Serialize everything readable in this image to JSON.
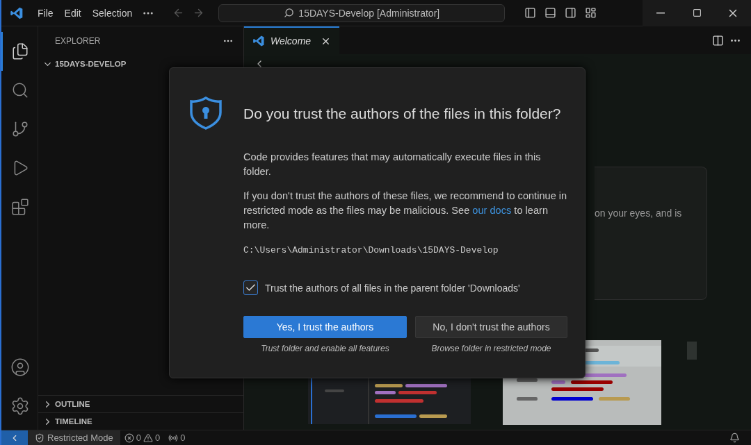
{
  "title_bar": {
    "menu": [
      "File",
      "Edit",
      "Selection"
    ],
    "search": "15DAYS-Develop [Administrator]"
  },
  "activity_bar": {
    "items": [
      {
        "kind": "explorer",
        "selected": true
      },
      {
        "kind": "search",
        "selected": false
      },
      {
        "kind": "source-control",
        "selected": false
      },
      {
        "kind": "run",
        "selected": false
      },
      {
        "kind": "extensions",
        "selected": false
      }
    ],
    "bottom": [
      {
        "kind": "account"
      },
      {
        "kind": "settings"
      }
    ]
  },
  "sidebar": {
    "title": "EXPLORER",
    "sections": [
      {
        "label": "15DAYS-DEVELOP",
        "expanded": true
      },
      {
        "label": "OUTLINE",
        "expanded": false
      },
      {
        "label": "TIMELINE",
        "expanded": false
      }
    ]
  },
  "editor": {
    "tabs": [
      {
        "label": "Welcome",
        "selected": true
      }
    ],
    "card_text": "on your eyes, and is"
  },
  "dialog": {
    "title": "Do you trust the authors of the files in this folder?",
    "paragraphs": [
      {
        "before": "Code provides features that may automatically execute files in this folder."
      },
      {
        "before": "If you don't trust the authors of these files, we recommend to continue in restricted mode as the files may be malicious. See ",
        "link": "our docs",
        "after": " to learn more."
      }
    ],
    "path": "C:\\Users\\Administrator\\Downloads\\15DAYS-Develop",
    "checkbox": {
      "label": "Trust the authors of all files in the parent folder 'Downloads'",
      "checked": true
    },
    "buttons": [
      {
        "label": "Yes, I trust the authors",
        "caption": "Trust folder and enable all features",
        "kind": "primary"
      },
      {
        "label": "No, I don't trust the authors",
        "caption": "Browse folder in restricted mode",
        "kind": "secondary"
      }
    ]
  },
  "status_bar": {
    "mode": "Restricted Mode",
    "errors": "0",
    "warnings": "0",
    "ports": "0"
  }
}
